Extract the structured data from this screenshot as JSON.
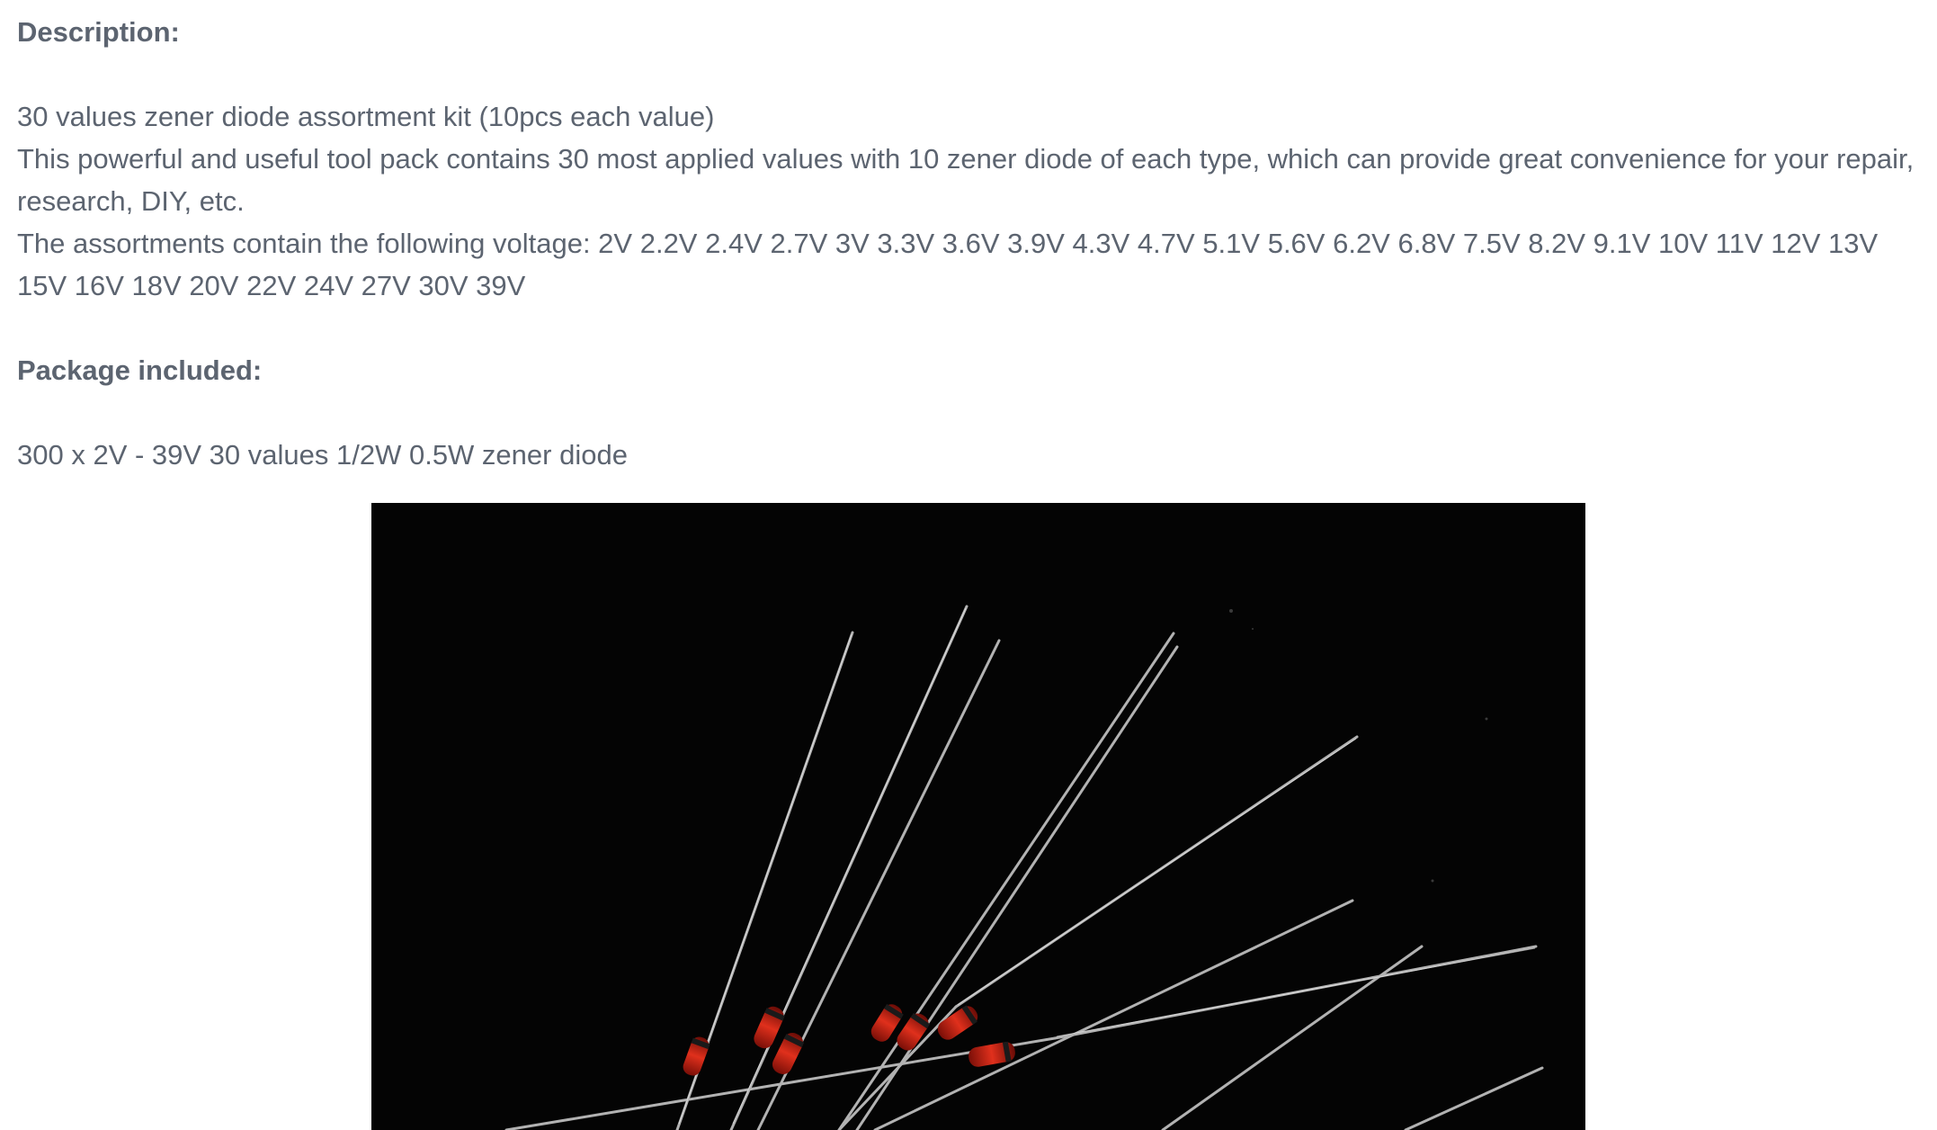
{
  "description": {
    "heading": "Description:",
    "lines": [
      "30 values zener diode assortment kit (10pcs each value)",
      "This powerful and useful tool pack contains 30 most applied values with 10 zener diode of each type, which can provide great convenience for your repair, research, DIY, etc.",
      "The assortments contain the following voltage: 2V 2.2V 2.4V 2.7V 3V 3.3V 3.6V 3.9V 4.3V 4.7V 5.1V 5.6V 6.2V 6.8V 7.5V 8.2V 9.1V 10V 11V 12V 13V 15V 16V 18V 20V 22V 24V 27V 30V 39V"
    ]
  },
  "package": {
    "heading": "Package included:",
    "line": "300 x 2V - 39V 30 values 1/2W 0.5W zener diode"
  },
  "colors": {
    "text": "#5c6470",
    "photo_background": "#040404",
    "diode_body": "#c0281a"
  }
}
